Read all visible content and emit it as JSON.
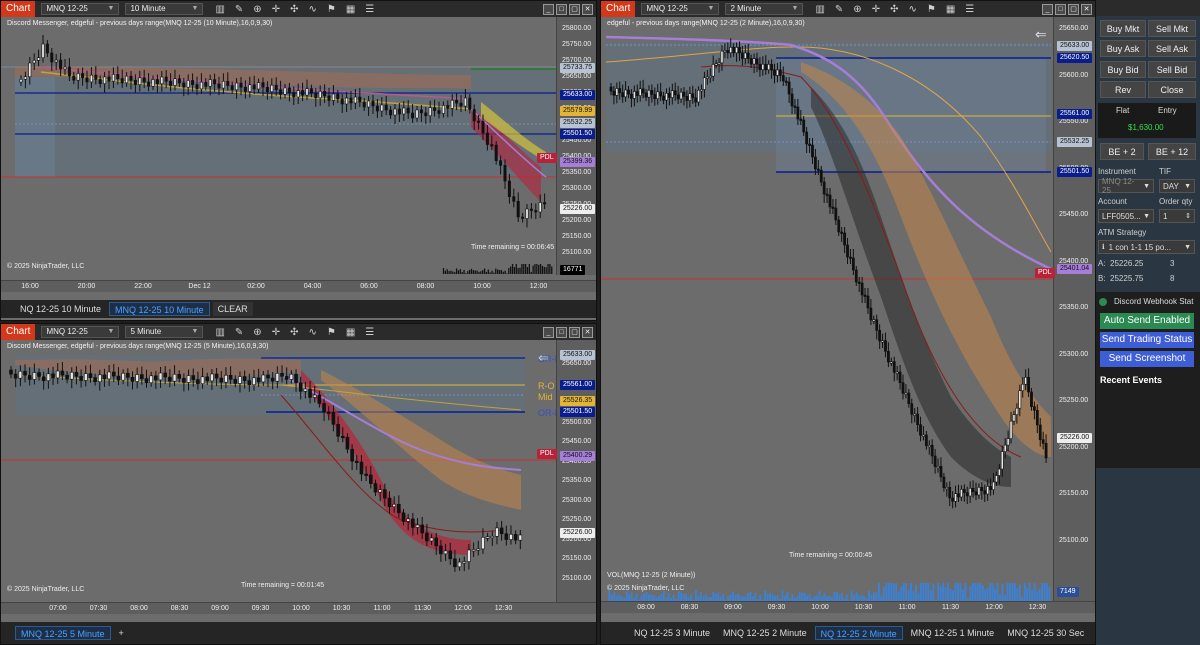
{
  "colors": {
    "chart_tag": "#d2381a",
    "pdl": "#b8233a",
    "navy_line": "#0a1d8c",
    "red_line": "#c83232",
    "green_btn": "#2a8a52",
    "blue_btn": "#3e5ed8",
    "pnl_green": "#2ee04a"
  },
  "window_tl": {
    "tag": "Chart",
    "instrument": "MNQ 12-25",
    "interval": "10 Minute",
    "indicator": "Discord Messenger, edgeful - previous days range(MNQ 12-25 (10 Minute),16,0,9,30)",
    "copyright": "© 2025 NinjaTrader, LLC",
    "time_remaining": "Time remaining = 00:06:45",
    "y_ticks": [
      "25800.00",
      "25750.00",
      "25700.00",
      "25650.00",
      "25600.00",
      "25550.00",
      "25500.00",
      "25450.00",
      "25400.00",
      "25350.00",
      "25300.00",
      "25250.00",
      "25200.00",
      "25150.00",
      "25100.00"
    ],
    "badges": [
      {
        "text": "25733.75"
      },
      {
        "text": "25633.00"
      },
      {
        "text": "25579.99"
      },
      {
        "text": "25532.25"
      },
      {
        "text": "25501.50"
      },
      {
        "text": "PDL"
      },
      {
        "text": "25399.36"
      },
      {
        "text": "25226.00"
      },
      {
        "text": "16771"
      }
    ],
    "x_ticks": [
      "16:00",
      "20:00",
      "22:00",
      "Dec 12",
      "02:00",
      "04:00",
      "06:00",
      "08:00",
      "10:00",
      "12:00"
    ],
    "tabs": [
      {
        "label": "NQ 12-25 10 Minute"
      },
      {
        "label": "MNQ 12-25 10 Minute"
      },
      {
        "label": "CLEAR"
      }
    ]
  },
  "window_bl": {
    "tag": "Chart",
    "instrument": "MNQ 12-25",
    "interval": "5 Minute",
    "indicator": "Discord Messenger, edgeful - previous days range(MNQ 12-25 (5 Minute),16,0,9,30)",
    "copyright": "© 2025 NinjaTrader, LLC",
    "time_remaining": "Time remaining = 00:01:45",
    "y_ticks": [
      "25650.00",
      "25600.00",
      "25550.00",
      "25500.00",
      "25450.00",
      "25400.00",
      "25350.00",
      "25300.00",
      "25250.00",
      "25200.00",
      "25150.00",
      "25100.00"
    ],
    "labels": [
      "OR-H",
      "R-O",
      "Mid",
      "OR-L"
    ],
    "badges": [
      {
        "text": "25633.00"
      },
      {
        "text": "25561.00"
      },
      {
        "text": "25526.35"
      },
      {
        "text": "25501.50"
      },
      {
        "text": "PDL"
      },
      {
        "text": "25400.29"
      },
      {
        "text": "25226.00"
      }
    ],
    "x_ticks": [
      "07:00",
      "07:30",
      "08:00",
      "08:30",
      "09:00",
      "09:30",
      "10:00",
      "10:30",
      "11:00",
      "11:30",
      "12:00",
      "12:30"
    ],
    "tabs": [
      {
        "label": "MNQ 12-25 5 Minute"
      },
      {
        "label": "+"
      }
    ]
  },
  "window_r": {
    "tag": "Chart",
    "instrument": "MNQ 12-25",
    "interval": "2 Minute",
    "indicator": "edgeful - previous days range(MNQ 12-25 (2 Minute),16,0,9,30)",
    "copyright": "© 2025 NinjaTrader, LLC",
    "time_remaining": "Time remaining = 00:00:45",
    "volume_label": "VOL(MNQ 12-25 (2 Minute))",
    "y_ticks": [
      "25650.00",
      "25600.00",
      "25550.00",
      "25500.00",
      "25450.00",
      "25400.00",
      "25350.00",
      "25300.00",
      "25250.00",
      "25200.00",
      "25150.00",
      "25100.00"
    ],
    "badges": [
      {
        "text": "25633.00"
      },
      {
        "text": "25620.50"
      },
      {
        "text": "25561.00"
      },
      {
        "text": "25532.25"
      },
      {
        "text": "25501.50"
      },
      {
        "text": "PDL"
      },
      {
        "text": "25401.04"
      },
      {
        "text": "25226.00"
      },
      {
        "text": "7149"
      }
    ],
    "x_ticks": [
      "08:00",
      "08:30",
      "09:00",
      "09:30",
      "10:00",
      "10:30",
      "11:00",
      "11:30",
      "12:00",
      "12:30"
    ],
    "tabs": [
      {
        "label": "NQ 12-25 3 Minute"
      },
      {
        "label": "MNQ 12-25 2 Minute"
      },
      {
        "label": "NQ 12-25 2 Minute"
      },
      {
        "label": "MNQ 12-25 1 Minute"
      },
      {
        "label": "MNQ 12-25 30 Sec"
      }
    ]
  },
  "panel": {
    "buy_mkt": "Buy Mkt",
    "sell_mkt": "Sell Mkt",
    "buy_ask": "Buy Ask",
    "sell_ask": "Sell Ask",
    "buy_bid": "Buy Bid",
    "sell_bid": "Sell Bid",
    "rev": "Rev",
    "close": "Close",
    "position": "Flat",
    "entry": "Entry",
    "pnl": "$1,630.00",
    "be2": "BE + 2",
    "be12": "BE + 12",
    "instrument_label": "Instrument",
    "tif_label": "TIF",
    "instrument_value": "MNQ 12-25",
    "tif_value": "DAY",
    "account_label": "Account",
    "order_qty_label": "Order qty",
    "account_value": "LFF0505...",
    "qty_value": "1",
    "atm_label": "ATM Strategy",
    "atm_value": "1 con 1-1 15 po...",
    "ask_label": "A:",
    "ask_price": "25226.25",
    "ask_size": "3",
    "bid_label": "B:",
    "bid_price": "25225.75",
    "bid_size": "8",
    "discord_title": "Discord Webhook Stat",
    "auto_send": "Auto Send Enabled",
    "send_status": "Send Trading Status",
    "send_screenshot": "Send Screenshot",
    "recent_events": "Recent Events"
  }
}
